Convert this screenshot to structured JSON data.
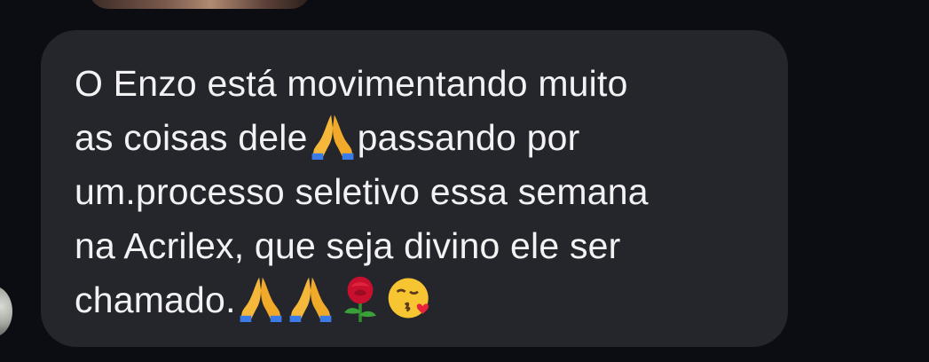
{
  "conversation": {
    "message": {
      "line1": "O Enzo está movimentando muito",
      "line2_start": "as coisas dele",
      "line2_end": "passando por",
      "line3": "um.processo seletivo essa semana",
      "line4": "na Acrilex, que seja divino ele ser",
      "line5": "chamado.",
      "emojis": [
        "praying-hands-emoji",
        "praying-hands-emoji",
        "praying-hands-emoji",
        "rose-emoji",
        "face-blowing-kiss-emoji"
      ]
    },
    "colors": {
      "background": "#0b0d12",
      "bubble": "#24262b",
      "text": "#f2f2f4"
    }
  }
}
